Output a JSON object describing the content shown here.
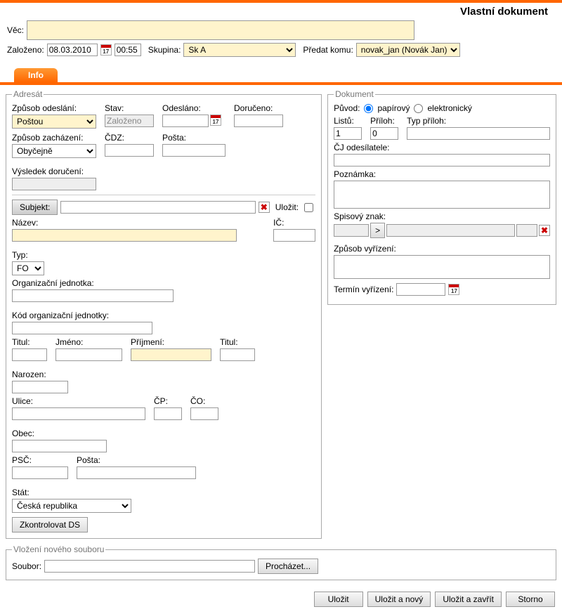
{
  "title": "Vlastní dokument",
  "header": {
    "vec_label": "Věc:",
    "vec_value": "",
    "zalozeno_label": "Založeno:",
    "zalozeno_date": "08.03.2010",
    "zalozeno_time": "00:55",
    "skupina_label": "Skupina:",
    "skupina_value": "Sk A",
    "predat_label": "Předat komu:",
    "predat_value": "novak_jan (Novák Jan)"
  },
  "tabs": {
    "info": "Info"
  },
  "adresat": {
    "legend": "Adresát",
    "zpusob_odeslani_label": "Způsob odeslání:",
    "zpusob_odeslani_value": "Poštou",
    "stav_label": "Stav:",
    "stav_value": "Založeno",
    "odeslano_label": "Odesláno:",
    "doruceno_label": "Doručeno:",
    "zpusob_zachazeni_label": "Způsob zacházení:",
    "zpusob_zachazeni_value": "Obyčejně",
    "cdz_label": "ČDZ:",
    "posta_label": "Pošta:",
    "vysledek_label": "Výsledek doručení:",
    "subjekt_btn": "Subjekt:",
    "ulozit_label": "Uložit:",
    "nazev_label": "Název:",
    "ic_label": "IČ:",
    "typ_label": "Typ:",
    "typ_value": "FO",
    "org_label": "Organizační jednotka:",
    "kod_org_label": "Kód organizační jednotky:",
    "titul1_label": "Titul:",
    "jmeno_label": "Jméno:",
    "prijmeni_label": "Příjmení:",
    "titul2_label": "Titul:",
    "narozen_label": "Narozen:",
    "ulice_label": "Ulice:",
    "cp_label": "ČP:",
    "co_label": "ČO:",
    "obec_label": "Obec:",
    "psc_label": "PSČ:",
    "posta2_label": "Pošta:",
    "stat_label": "Stát:",
    "stat_value": "Česká republika",
    "zkontrolovat_btn": "Zkontrolovat DS"
  },
  "dokument": {
    "legend": "Dokument",
    "puvod_label": "Původ:",
    "papirovy": "papírový",
    "elektronicky": "elektronický",
    "listu_label": "Listů:",
    "listu_value": "1",
    "priloh_label": "Příloh:",
    "priloh_value": "0",
    "typ_priloh_label": "Typ příloh:",
    "cj_label": "ČJ odesílatele:",
    "poznamka_label": "Poznámka:",
    "spisovy_label": "Spisový znak:",
    "spisovy_btn": ">",
    "zpusob_vyrizeni_label": "Způsob vyřízení:",
    "termin_label": "Termín vyřízení:"
  },
  "soubor": {
    "legend": "Vložení nového souboru",
    "soubor_label": "Soubor:",
    "prochazet_btn": "Procházet..."
  },
  "footer": {
    "ulozit": "Uložit",
    "ulozit_novy": "Uložit a nový",
    "ulozit_zavrit": "Uložit a zavřít",
    "storno": "Storno"
  }
}
